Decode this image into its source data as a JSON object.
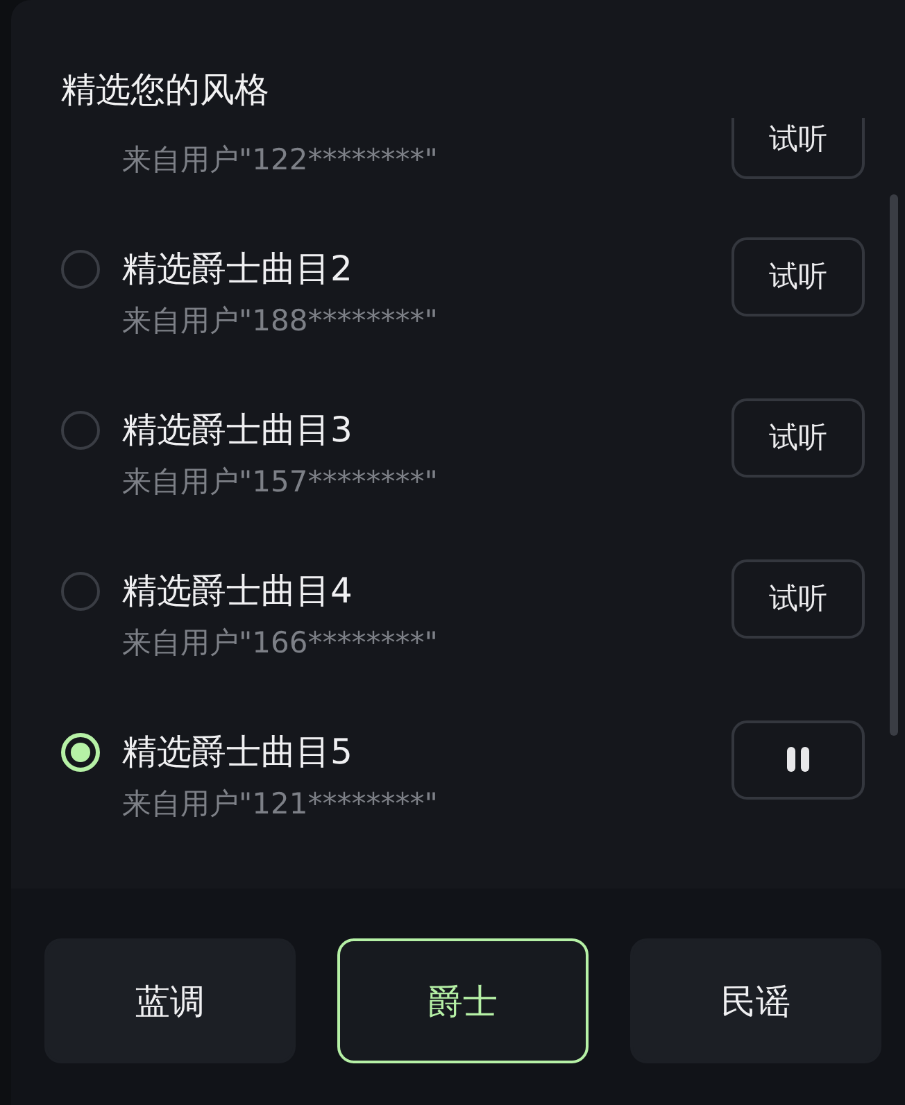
{
  "title": "精选您的风格",
  "tracks": [
    {
      "subtitle": "来自用户\"122********\"",
      "button": {
        "kind": "listen",
        "label": "试听"
      }
    },
    {
      "title": "精选爵士曲目2",
      "subtitle": "来自用户\"188********\"",
      "selected": false,
      "button": {
        "kind": "listen",
        "label": "试听"
      }
    },
    {
      "title": "精选爵士曲目3",
      "subtitle": "来自用户\"157********\"",
      "selected": false,
      "button": {
        "kind": "listen",
        "label": "试听"
      }
    },
    {
      "title": "精选爵士曲目4",
      "subtitle": "来自用户\"166********\"",
      "selected": false,
      "button": {
        "kind": "listen",
        "label": "试听"
      }
    },
    {
      "title": "精选爵士曲目5",
      "subtitle": "来自用户\"121********\"",
      "selected": true,
      "button": {
        "kind": "pause"
      }
    }
  ],
  "styles": [
    {
      "label": "蓝调",
      "selected": false
    },
    {
      "label": "爵士",
      "selected": true
    },
    {
      "label": "民谣",
      "selected": false
    }
  ]
}
